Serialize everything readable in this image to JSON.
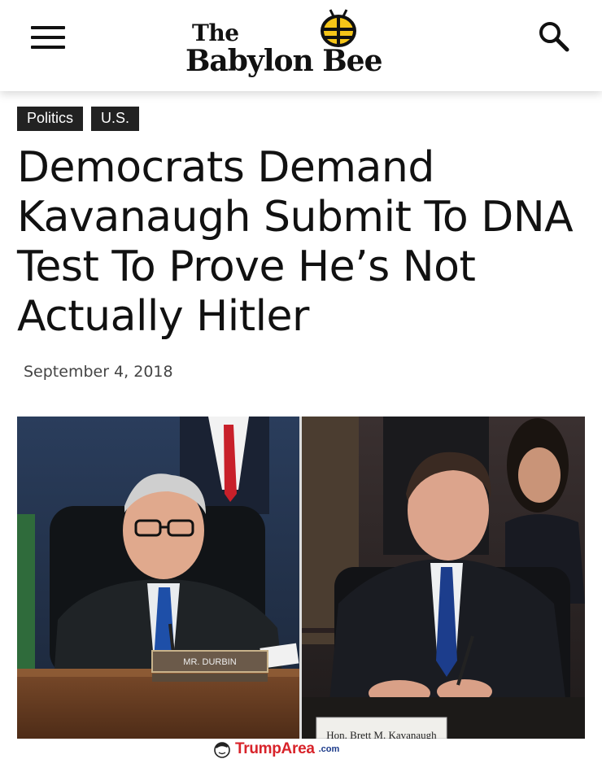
{
  "header": {
    "logo_line1": "The",
    "logo_line2": "Babylon Bee",
    "menu_icon": "hamburger-menu-icon",
    "search_icon": "search-icon"
  },
  "article": {
    "tags": [
      "Politics",
      "U.S."
    ],
    "headline": "Democrats Demand Kavanaugh Submit To DNA Test To Prove He’s Not Actually Hitler",
    "date": "September 4, 2018",
    "photo": {
      "left_nameplate": "MR. DURBIN",
      "right_nameplate": "Hon. Brett M. Kavanaugh"
    }
  },
  "watermark": {
    "brand": "TrumpArea",
    "suffix": ".com"
  },
  "colors": {
    "tag_background": "#222222",
    "watermark_red": "#d8232a",
    "watermark_blue": "#1b3a8a"
  }
}
